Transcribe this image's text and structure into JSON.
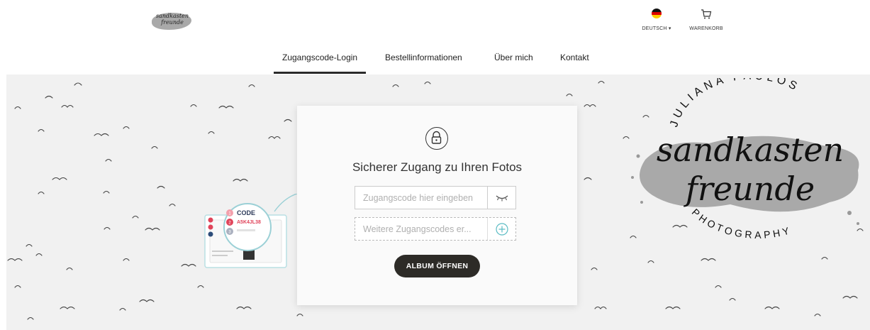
{
  "header": {
    "logo_text": "sandkasten freunde",
    "language": {
      "label": "DEUTSCH ▾",
      "flag_colors": [
        "#111111",
        "#dd0000",
        "#ffce00"
      ]
    },
    "cart": {
      "label": "WARENKORB"
    },
    "nav": [
      {
        "label": "Zugangscode-Login",
        "active": true
      },
      {
        "label": "Bestellinformationen",
        "active": false
      },
      {
        "label": "Über mich",
        "active": false
      },
      {
        "label": "Kontakt",
        "active": false
      }
    ]
  },
  "login": {
    "icon": "padlock-icon",
    "title": "Sicherer Zugang zu Ihren Fotos",
    "code_field": {
      "placeholder": "Zugangscode hier eingeben",
      "value": "",
      "toggle_icon": "eye-closed-icon"
    },
    "more_codes_field": {
      "placeholder": "Weitere Zugangscodes er...",
      "value": "",
      "add_icon": "plus-circle-icon"
    },
    "submit_label": "ALBUM ÖFFNEN"
  },
  "illustration": {
    "code_label": "CODE",
    "code_value": "A5K4JL38"
  },
  "brand": {
    "arc_top": "JULIANA PAULOS",
    "script_line1": "sandkasten",
    "script_line2": "freunde",
    "arc_bottom": "PHOTOGRAPHY"
  },
  "colors": {
    "accent_teal": "#5bbcc4",
    "button_dark": "#2d2b27",
    "hero_bg": "#f1f1f1",
    "code_red": "#e0445a"
  }
}
